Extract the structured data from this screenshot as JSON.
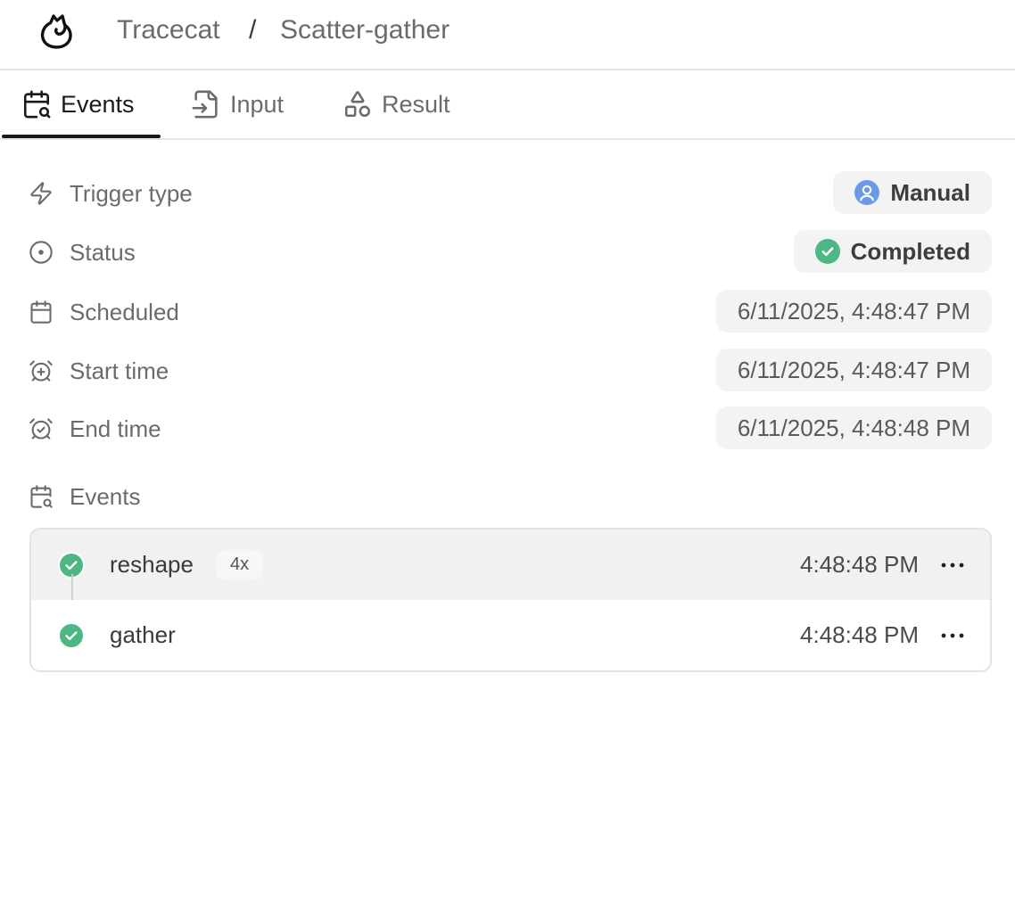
{
  "header": {
    "app": "Tracecat",
    "separator": "/",
    "page": "Scatter-gather"
  },
  "tabs": [
    {
      "label": "Events",
      "icon": "calendar-search-icon",
      "active": true
    },
    {
      "label": "Input",
      "icon": "file-input-icon",
      "active": false
    },
    {
      "label": "Result",
      "icon": "shapes-icon",
      "active": false
    }
  ],
  "details": {
    "trigger": {
      "label": "Trigger type",
      "value": "Manual",
      "icon": "zap-icon"
    },
    "status": {
      "label": "Status",
      "value": "Completed",
      "icon": "circle-dot-icon"
    },
    "scheduled": {
      "label": "Scheduled",
      "value": "6/11/2025, 4:48:47 PM",
      "icon": "calendar-icon"
    },
    "start": {
      "label": "Start time",
      "value": "6/11/2025, 4:48:47 PM",
      "icon": "alarm-plus-icon"
    },
    "end": {
      "label": "End time",
      "value": "6/11/2025, 4:48:48 PM",
      "icon": "alarm-check-icon"
    }
  },
  "events_section": {
    "label": "Events"
  },
  "events": [
    {
      "name": "reshape",
      "badge": "4x",
      "time": "4:48:48 PM",
      "status": "completed"
    },
    {
      "name": "gather",
      "badge": "",
      "time": "4:48:48 PM",
      "status": "completed"
    }
  ],
  "colors": {
    "success": "#4cb782",
    "user": "#6b9be8",
    "active_tab": "#1a1a1a"
  }
}
